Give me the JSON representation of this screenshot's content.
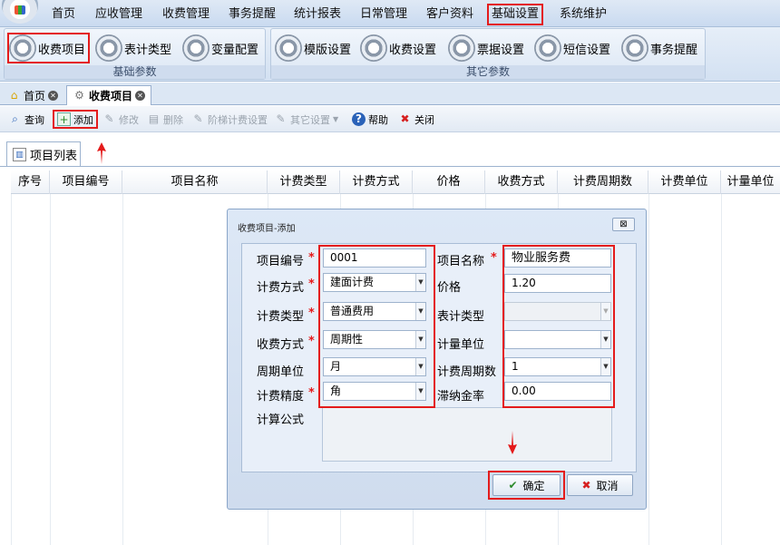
{
  "menu": [
    "首页",
    "应收管理",
    "收费管理",
    "事务提醒",
    "统计报表",
    "日常管理",
    "客户资料",
    "基础设置",
    "系统维护"
  ],
  "ribbon": {
    "group1": {
      "label": "基础参数",
      "buttons": [
        "收费项目",
        "表计类型",
        "变量配置"
      ]
    },
    "group2": {
      "label": "其它参数",
      "buttons": [
        "模版设置",
        "收费设置",
        "票据设置",
        "短信设置",
        "事务提醒"
      ]
    }
  },
  "tabs": [
    "首页",
    "收费项目"
  ],
  "toolbar": [
    "查询",
    "添加",
    "修改",
    "删除",
    "阶梯计费设置",
    "其它设置",
    "帮助",
    "关闭"
  ],
  "list_tab": "项目列表",
  "columns": [
    "序号",
    "项目编号",
    "项目名称",
    "计费类型",
    "计费方式",
    "价格",
    "收费方式",
    "计费周期数",
    "计费单位",
    "计量单位"
  ],
  "dialog": {
    "title": "收费项目-添加",
    "close": "⊠",
    "fields": {
      "item_no": {
        "label": "项目编号",
        "value": "0001"
      },
      "item_name": {
        "label": "项目名称",
        "value": "物业服务费"
      },
      "billing_method": {
        "label": "计费方式",
        "value": "建面计费"
      },
      "price": {
        "label": "价格",
        "value": "1.20"
      },
      "billing_type": {
        "label": "计费类型",
        "value": "普通费用"
      },
      "meter_type": {
        "label": "表计类型",
        "value": ""
      },
      "charge_method": {
        "label": "收费方式",
        "value": "周期性"
      },
      "measure_unit": {
        "label": "计量单位",
        "value": ""
      },
      "cycle_unit": {
        "label": "周期单位",
        "value": "月"
      },
      "cycle_count": {
        "label": "计费周期数",
        "value": "1"
      },
      "precision": {
        "label": "计费精度",
        "value": "角"
      },
      "late_fee_rate": {
        "label": "滞纳金率",
        "value": "0.00"
      },
      "formula": {
        "label": "计算公式",
        "value": ""
      }
    },
    "required_mark": "*",
    "ok": "确定",
    "cancel": "取消"
  },
  "colors": {
    "highlight": "#e41b1b",
    "accent": "#1f6fd1"
  }
}
